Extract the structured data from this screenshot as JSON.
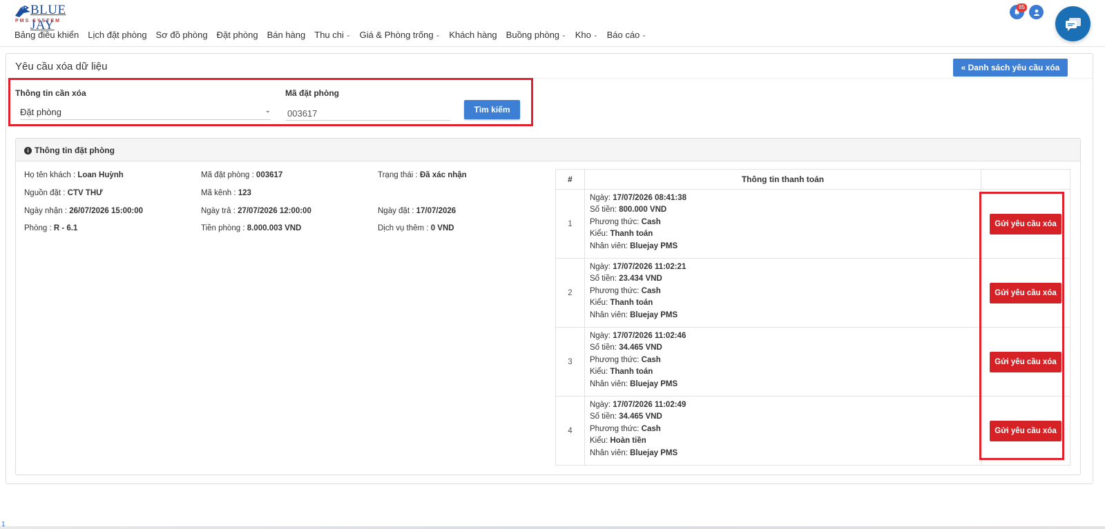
{
  "brand": {
    "name": "BLUE JAY",
    "subtitle": "PMS SYSTEM"
  },
  "nav": [
    {
      "label": "Bảng điều khiển",
      "dropdown": false
    },
    {
      "label": "Lịch đặt phòng",
      "dropdown": false
    },
    {
      "label": "Sơ đồ phòng",
      "dropdown": false
    },
    {
      "label": "Đặt phòng",
      "dropdown": false
    },
    {
      "label": "Bán hàng",
      "dropdown": false
    },
    {
      "label": "Thu chi",
      "dropdown": true
    },
    {
      "label": "Giá & Phòng trống",
      "dropdown": true
    },
    {
      "label": "Khách hàng",
      "dropdown": false
    },
    {
      "label": "Buồng phòng",
      "dropdown": true
    },
    {
      "label": "Kho",
      "dropdown": true
    },
    {
      "label": "Báo cáo",
      "dropdown": true
    }
  ],
  "header_icons": {
    "notification_count": "85",
    "bell": "bell-icon",
    "user": "user-icon",
    "chat": "chat-icon"
  },
  "page": {
    "title": "Yêu cầu xóa dữ liệu",
    "list_button": "« Danh sách yêu cầu xóa"
  },
  "search": {
    "type_label": "Thông tin cần xóa",
    "type_value": "Đặt phòng",
    "code_label": "Mã đặt phòng",
    "code_value": "003617",
    "button": "Tìm kiếm"
  },
  "booking": {
    "section_title": "Thông tin đặt phòng",
    "guest_label": "Họ tên khách : ",
    "guest": "Loan Huỳnh",
    "code_label": "Mã đặt phòng : ",
    "code": "003617",
    "status_label": "Trạng thái : ",
    "status": "Đã xác nhận",
    "source_label": "Nguồn đặt : ",
    "source": "CTV THƯ",
    "channel_label": "Mã kênh : ",
    "channel": "123",
    "checkin_label": "Ngày nhận : ",
    "checkin": "26/07/2026 15:00:00",
    "checkout_label": "Ngày trả : ",
    "checkout": "27/07/2026 12:00:00",
    "booked_label": "Ngày đặt : ",
    "booked": "17/07/2026",
    "room_label": "Phòng : ",
    "room": "R - 6.1",
    "room_price_label": "Tiền phòng : ",
    "room_price": "8.000.003 VND",
    "extra_label": "Dịch vụ thêm : ",
    "extra": "0 VND"
  },
  "payments": {
    "col_num": "#",
    "col_info": "Thông tin thanh toán",
    "col_action": "",
    "date_label": "Ngày: ",
    "amount_label": "Số tiền: ",
    "method_label": "Phương thức: ",
    "kind_label": "Kiểu: ",
    "staff_label": "Nhân viên: ",
    "button": "Gửi yêu cầu xóa",
    "rows": [
      {
        "num": "1",
        "date": "17/07/2026 08:41:38",
        "amount": "800.000 VND",
        "method": "Cash",
        "kind": "Thanh toán",
        "staff": "Bluejay PMS"
      },
      {
        "num": "2",
        "date": "17/07/2026 11:02:21",
        "amount": "23.434 VND",
        "method": "Cash",
        "kind": "Thanh toán",
        "staff": "Bluejay PMS"
      },
      {
        "num": "3",
        "date": "17/07/2026 11:02:46",
        "amount": "34.465 VND",
        "method": "Cash",
        "kind": "Thanh toán",
        "staff": "Bluejay PMS"
      },
      {
        "num": "4",
        "date": "17/07/2026 11:02:49",
        "amount": "34.465 VND",
        "method": "Cash",
        "kind": "Hoàn tiền",
        "staff": "Bluejay PMS"
      }
    ]
  },
  "footer": {
    "page_num": "1"
  },
  "colors": {
    "primary": "#3d7fd4",
    "danger": "#d42227",
    "highlight": "#e0202a",
    "brand": "#1d4f9c"
  }
}
